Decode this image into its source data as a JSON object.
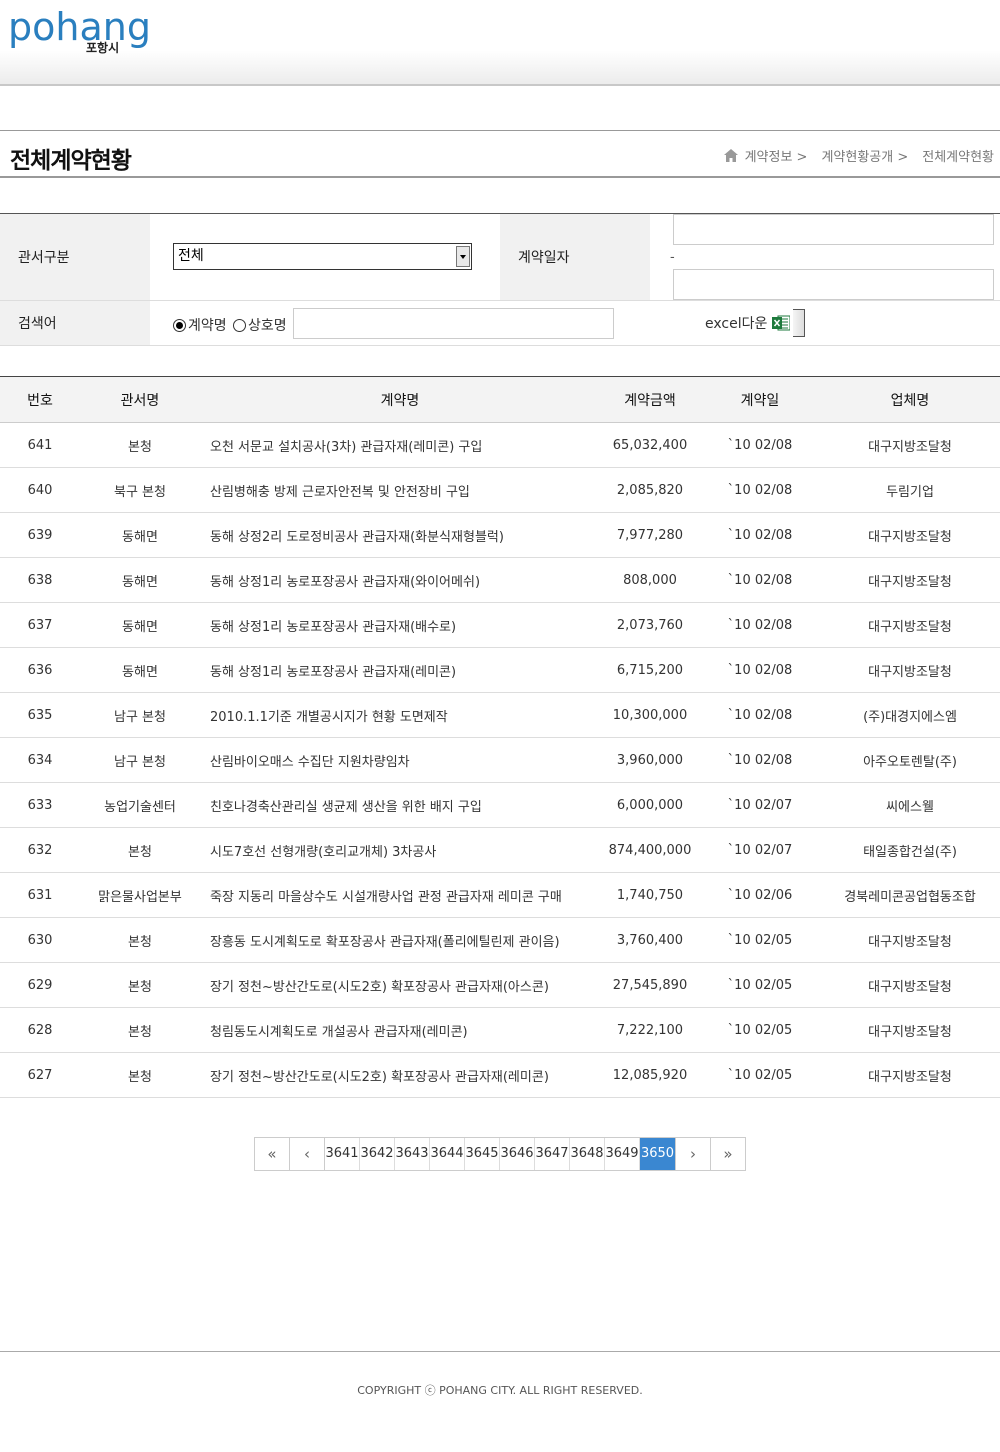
{
  "header": {
    "logo_text": "pohang",
    "logo_subtext": "포항시"
  },
  "page": {
    "title": "전체계약현황",
    "breadcrumb": [
      "계약정보 >",
      "계약현황공개 >",
      "전체계약현황"
    ]
  },
  "search": {
    "dept_label": "관서구분",
    "dept_selected": "전체",
    "date_label": "계약일자",
    "date_separator": "-",
    "keyword_label": "검색어",
    "radio_contract": "계약명",
    "radio_company": "상호명",
    "radio_selected": "계약명",
    "excel_label": "excel다운"
  },
  "table": {
    "headers": [
      "번호",
      "관서명",
      "계약명",
      "계약금액",
      "계약일",
      "업체명"
    ],
    "rows": [
      {
        "no": "641",
        "dept": "본청",
        "name": "오천 서문교 설치공사(3차) 관급자재(레미콘) 구입",
        "amount": "65,032,400",
        "date": "`10 02/08",
        "company": "대구지방조달청"
      },
      {
        "no": "640",
        "dept": "북구 본청",
        "name": "산림병해충 방제 근로자안전복 및 안전장비 구입",
        "amount": "2,085,820",
        "date": "`10 02/08",
        "company": "두림기업"
      },
      {
        "no": "639",
        "dept": "동해면",
        "name": "동해 상정2리 도로정비공사 관급자재(화분식재형블럭)",
        "amount": "7,977,280",
        "date": "`10 02/08",
        "company": "대구지방조달청"
      },
      {
        "no": "638",
        "dept": "동해면",
        "name": "동해 상정1리 농로포장공사 관급자재(와이어메쉬)",
        "amount": "808,000",
        "date": "`10 02/08",
        "company": "대구지방조달청"
      },
      {
        "no": "637",
        "dept": "동해면",
        "name": "동해 상정1리 농로포장공사 관급자재(배수로)",
        "amount": "2,073,760",
        "date": "`10 02/08",
        "company": "대구지방조달청"
      },
      {
        "no": "636",
        "dept": "동해면",
        "name": "동해 상정1리 농로포장공사 관급자재(레미콘)",
        "amount": "6,715,200",
        "date": "`10 02/08",
        "company": "대구지방조달청"
      },
      {
        "no": "635",
        "dept": "남구 본청",
        "name": "2010.1.1기준 개별공시지가 현황 도면제작",
        "amount": "10,300,000",
        "date": "`10 02/08",
        "company": "(주)대경지에스엠"
      },
      {
        "no": "634",
        "dept": "남구 본청",
        "name": "산림바이오매스 수집단 지원차량임차",
        "amount": "3,960,000",
        "date": "`10 02/08",
        "company": "아주오토렌탈(주)"
      },
      {
        "no": "633",
        "dept": "농업기술센터",
        "name": "친호나경축산관리실 생균제 생산을 위한 배지 구입",
        "amount": "6,000,000",
        "date": "`10 02/07",
        "company": "씨에스웰"
      },
      {
        "no": "632",
        "dept": "본청",
        "name": "시도7호선 선형개량(호리교개체) 3차공사",
        "amount": "874,400,000",
        "date": "`10 02/07",
        "company": "태일종합건설(주)"
      },
      {
        "no": "631",
        "dept": "맑은물사업본부",
        "name": "죽장 지동리 마을상수도 시설개량사업 관정 관급자재 레미콘 구매",
        "amount": "1,740,750",
        "date": "`10 02/06",
        "company": "경북레미콘공업협동조합"
      },
      {
        "no": "630",
        "dept": "본청",
        "name": "장흥동 도시계획도로 확포장공사 관급자재(폴리에틸린제 관이음)",
        "amount": "3,760,400",
        "date": "`10 02/05",
        "company": "대구지방조달청"
      },
      {
        "no": "629",
        "dept": "본청",
        "name": "장기 정천~방산간도로(시도2호) 확포장공사 관급자재(아스콘)",
        "amount": "27,545,890",
        "date": "`10 02/05",
        "company": "대구지방조달청"
      },
      {
        "no": "628",
        "dept": "본청",
        "name": "청림동도시계획도로 개설공사 관급자재(레미콘)",
        "amount": "7,222,100",
        "date": "`10 02/05",
        "company": "대구지방조달청"
      },
      {
        "no": "627",
        "dept": "본청",
        "name": "장기 정천~방산간도로(시도2호) 확포장공사 관급자재(레미콘)",
        "amount": "12,085,920",
        "date": "`10 02/05",
        "company": "대구지방조달청"
      }
    ]
  },
  "pagination": {
    "first": "«",
    "prev": "‹",
    "pages": [
      "3641",
      "3642",
      "3643",
      "3644",
      "3645",
      "3646",
      "3647",
      "3648",
      "3649",
      "3650"
    ],
    "active": "3650",
    "next": "›",
    "last": "»"
  },
  "footer": {
    "copyright": "COPYRIGHT ⓒ POHANG CITY. ALL RIGHT RESERVED."
  },
  "colors": {
    "logo_blue": "#2a7fbf",
    "active_page": "#3a87d1",
    "label_bg": "#f1f1f1",
    "excel_green": "#1e7a3c"
  }
}
